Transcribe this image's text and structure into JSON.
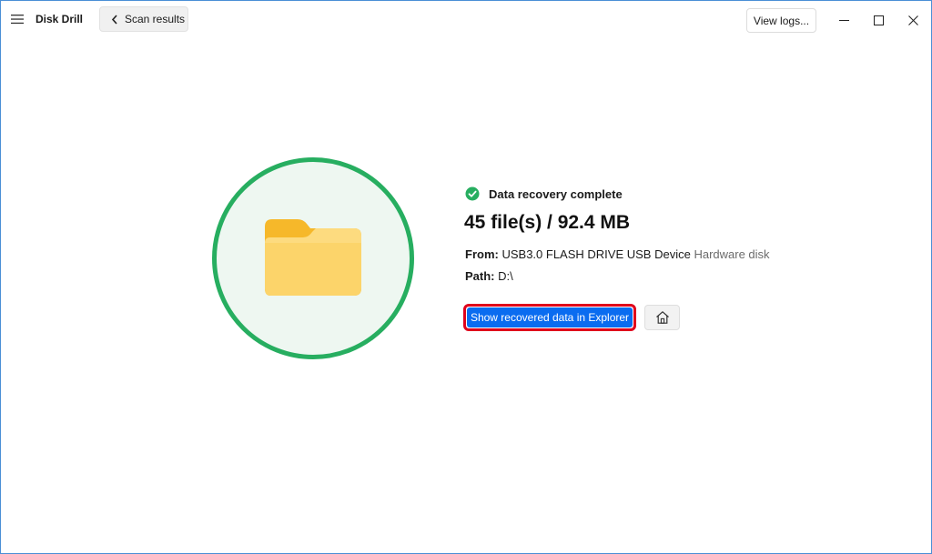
{
  "app": {
    "title": "Disk Drill"
  },
  "nav": {
    "back_label": "Scan results"
  },
  "header": {
    "logs_label": "View logs..."
  },
  "result": {
    "status": "Data recovery complete",
    "summary": "45 file(s) / 92.4 MB",
    "from_label": "From:",
    "from_device": "USB3.0 FLASH DRIVE USB Device",
    "from_type": "Hardware disk",
    "path_label": "Path:",
    "path_value": "D:\\",
    "explorer_button": "Show recovered data in Explorer"
  },
  "colors": {
    "accent": "#0a6cf0",
    "success": "#27ae60",
    "highlight": "#e0001b",
    "folder": "#fcd46a"
  },
  "icons": {
    "menu": "hamburger-icon",
    "back": "chevron-left-icon",
    "status": "check-circle-icon",
    "folder": "folder-icon",
    "home": "home-icon"
  }
}
